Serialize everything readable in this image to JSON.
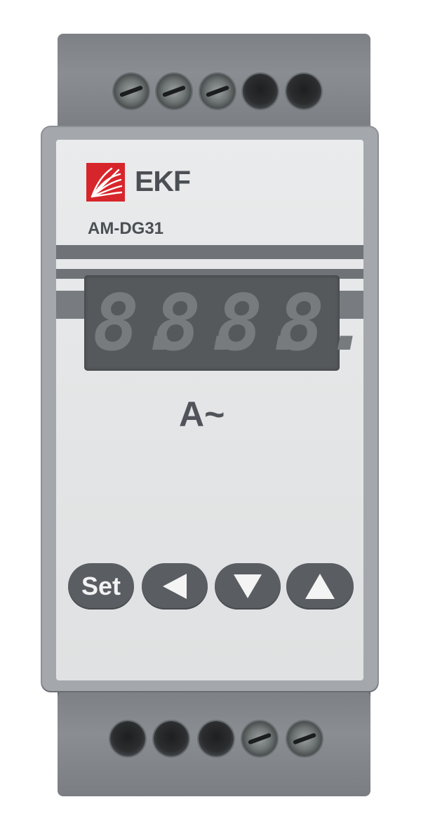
{
  "device": {
    "brand": "EKF",
    "model": "AM-DG31",
    "display_digits": [
      "8.",
      "8.",
      "8.",
      "8."
    ],
    "unit": "A~",
    "buttons": {
      "set_label": "Set",
      "left_icon": "left-arrow-icon",
      "down_icon": "down-arrow-icon",
      "up_icon": "up-arrow-icon"
    },
    "colors": {
      "brand_red": "#d7262b",
      "panel": "#e3e5e6",
      "housing": "#8a8e92",
      "button": "#5a5e63"
    }
  }
}
